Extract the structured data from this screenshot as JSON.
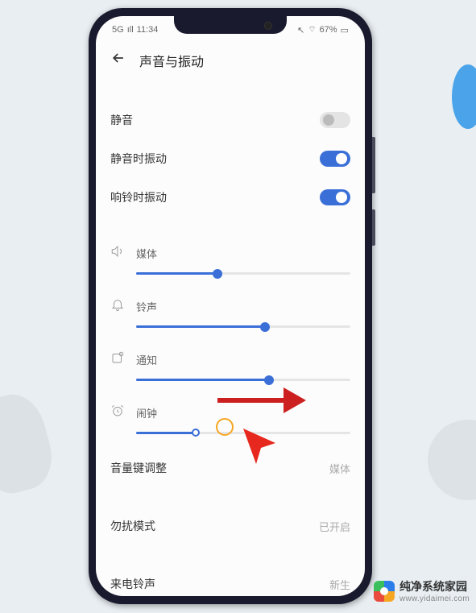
{
  "statusbar": {
    "net": "5G",
    "signal": "ıll",
    "time": "11:34",
    "arrow": "↖",
    "wifi": "⌔",
    "battery": "67%"
  },
  "header": {
    "title": "声音与振动"
  },
  "toggles": {
    "mute": {
      "label": "静音",
      "on": false
    },
    "vib_mute": {
      "label": "静音时振动",
      "on": true
    },
    "vib_ring": {
      "label": "响铃时振动",
      "on": true
    }
  },
  "sliders": {
    "media": {
      "label": "媒体",
      "pct": 38
    },
    "ring": {
      "label": "铃声",
      "pct": 60
    },
    "notif": {
      "label": "通知",
      "pct": 62
    },
    "alarm": {
      "label": "闹钟",
      "pct": 28
    }
  },
  "rows": {
    "volkey": {
      "label": "音量键调整",
      "value": "媒体"
    },
    "dnd": {
      "label": "勿扰模式",
      "value": "已开启"
    },
    "ringtone": {
      "label": "来电铃声",
      "value": "新生"
    }
  },
  "watermark": {
    "name": "纯净系统家园",
    "url": "www.yidaimei.com"
  }
}
